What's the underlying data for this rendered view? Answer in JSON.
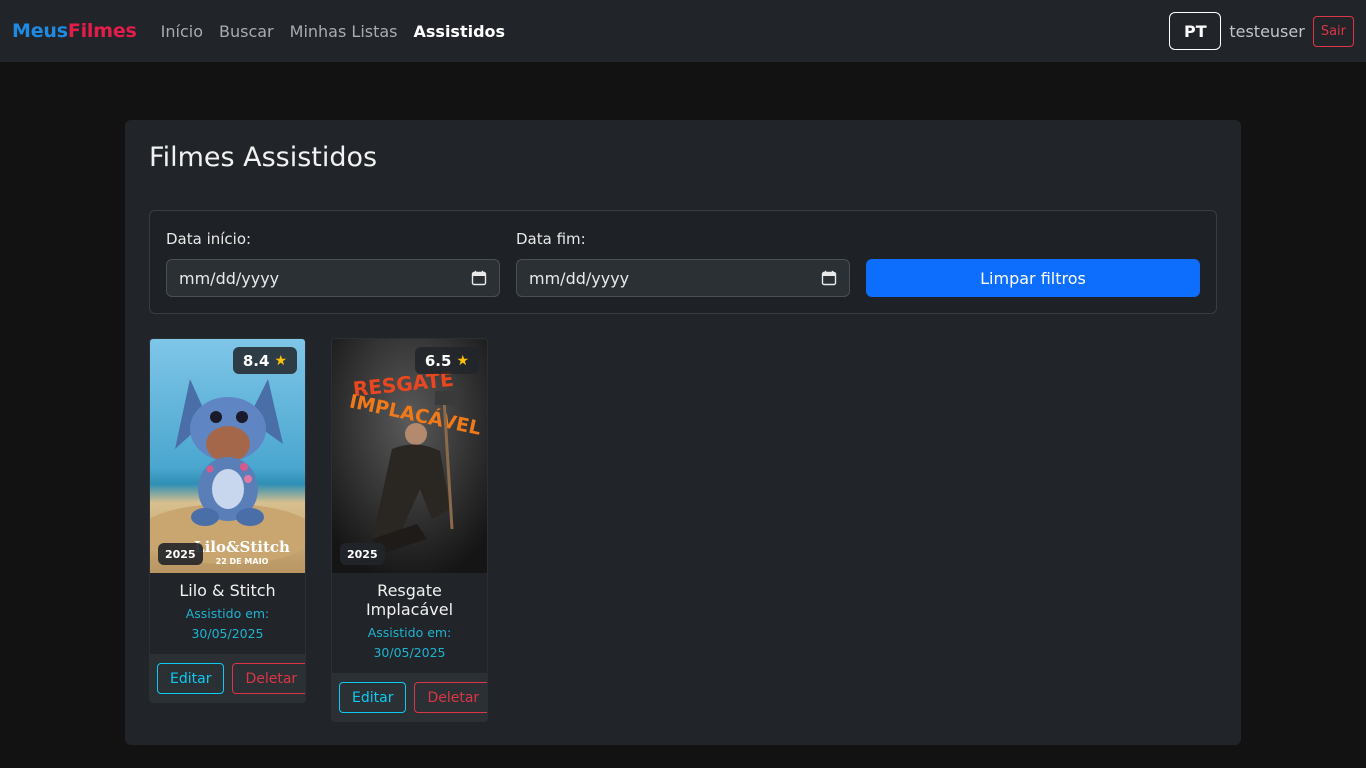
{
  "navbar": {
    "brand_part1": "Meus",
    "brand_part2": "Filmes",
    "links": [
      {
        "label": "Início",
        "active": false
      },
      {
        "label": "Buscar",
        "active": false
      },
      {
        "label": "Minhas Listas",
        "active": false
      },
      {
        "label": "Assistidos",
        "active": true
      }
    ],
    "language": "PT",
    "username": "testeuser",
    "logout_label": "Sair"
  },
  "page": {
    "title": "Filmes Assistidos"
  },
  "filters": {
    "start_label": "Data início:",
    "start_placeholder": "mm/dd/yyyy",
    "end_label": "Data fim:",
    "end_placeholder": "mm/dd/yyyy",
    "clear_label": "Limpar filtros"
  },
  "movies": [
    {
      "title": "Lilo & Stitch",
      "rating": "8.4",
      "year": "2025",
      "watched_label": "Assistido em:",
      "watched_date": "30/05/2025",
      "edit_label": "Editar",
      "delete_label": "Deletar"
    },
    {
      "title": "Resgate Implacável",
      "rating": "6.5",
      "year": "2025",
      "watched_label": "Assistido em:",
      "watched_date": "30/05/2025",
      "edit_label": "Editar",
      "delete_label": "Deletar"
    }
  ],
  "colors": {
    "brand_blue": "#1f8ae0",
    "brand_red": "#e21d4a",
    "primary": "#0d6efd",
    "info": "#0dcaf0",
    "danger": "#dc3545",
    "star": "#ffc107"
  }
}
